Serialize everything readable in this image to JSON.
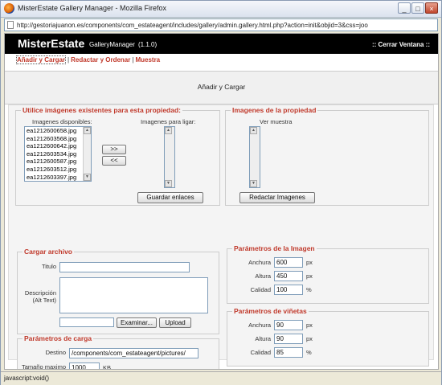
{
  "window": {
    "title": "MisterEstate Gallery Manager - Mozilla Firefox",
    "min": "_",
    "max": "□",
    "close": "×"
  },
  "address": {
    "url": "http://gestoriajuanon.es/components/com_estateagent/includes/gallery/admin.gallery.html.php?action=init&objid=3&css=joo"
  },
  "header": {
    "brand": "MisterEstate",
    "subtitle": "GalleryManager",
    "version": "(1.1.0)",
    "close_link": ":: Cerrar Ventana ::"
  },
  "nav": {
    "items": [
      "Añadir y Cargar",
      "Redactar y Ordenar",
      "Muestra"
    ],
    "sep": "|"
  },
  "page": {
    "title": "Añadir y Cargar"
  },
  "existing": {
    "legend": "Utilice imágenes existentes para esta propiedad:",
    "available_label": "Imagenes disponibles:",
    "link_label": "Imagenes para ligar:",
    "images": [
      "ea1212600658.jpg",
      "ea1212603568.jpg",
      "ea1212600642.jpg",
      "ea1212603534.jpg",
      "ea1212600587.jpg",
      "ea1212603512.jpg",
      "ea1212603397.jpg"
    ],
    "add_btn": ">>",
    "remove_btn": "<<",
    "save_btn": "Guardar enlaces"
  },
  "property_images": {
    "legend": "Imagenes de la propiedad",
    "preview_label": "Ver muestra",
    "edit_btn": "Redactar Imagenes"
  },
  "upload": {
    "legend": "Cargar archivo",
    "title_label": "Titulo",
    "title_value": "",
    "desc_label": "Descripción",
    "desc_label2": "(Alt Text)",
    "browse_btn": "Examinar...",
    "upload_btn": "Upload"
  },
  "load_params": {
    "legend": "Parámetros de carga",
    "dest_label": "Destino",
    "dest_value": "/components/com_estateagent/pictures/",
    "maxsize_label": "Tamaño maximo",
    "maxsize_value": "1000",
    "maxsize_unit": "KB"
  },
  "image_params": {
    "legend": "Parámetros de la Imagen",
    "width_label": "Anchura",
    "width_value": "600",
    "width_unit": "px",
    "height_label": "Altura",
    "height_value": "450",
    "height_unit": "px",
    "quality_label": "Calidad",
    "quality_value": "100",
    "quality_unit": "%"
  },
  "thumb_params": {
    "legend": "Parámetros de viñetas",
    "width_label": "Anchura",
    "width_value": "90",
    "width_unit": "px",
    "height_label": "Altura",
    "height_value": "90",
    "height_unit": "px",
    "quality_label": "Calidad",
    "quality_value": "85",
    "quality_unit": "%"
  },
  "status": {
    "text": "javascript:void()"
  }
}
